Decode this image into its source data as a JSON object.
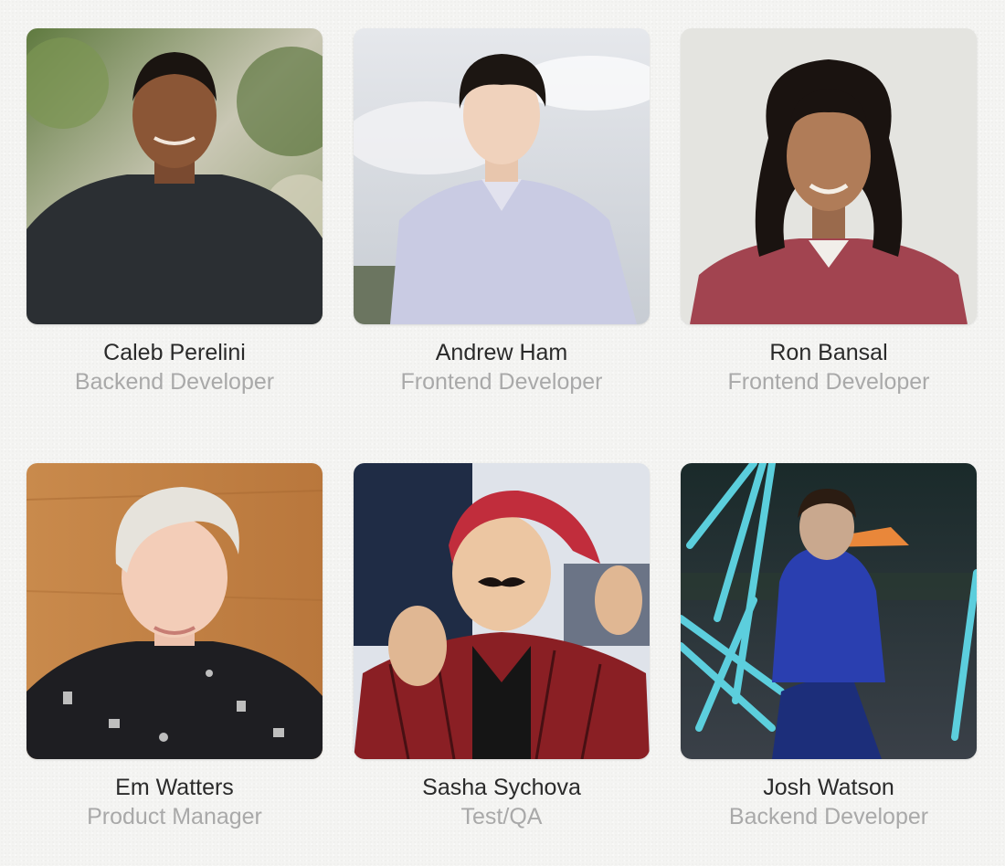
{
  "team": [
    {
      "name": "Caleb Perelini",
      "role": "Backend Developer"
    },
    {
      "name": "Andrew Ham",
      "role": "Frontend Developer"
    },
    {
      "name": "Ron Bansal",
      "role": "Frontend Developer"
    },
    {
      "name": "Em Watters",
      "role": "Product Manager"
    },
    {
      "name": "Sasha Sychova",
      "role": "Test/QA"
    },
    {
      "name": "Josh Watson",
      "role": "Backend Developer"
    }
  ]
}
